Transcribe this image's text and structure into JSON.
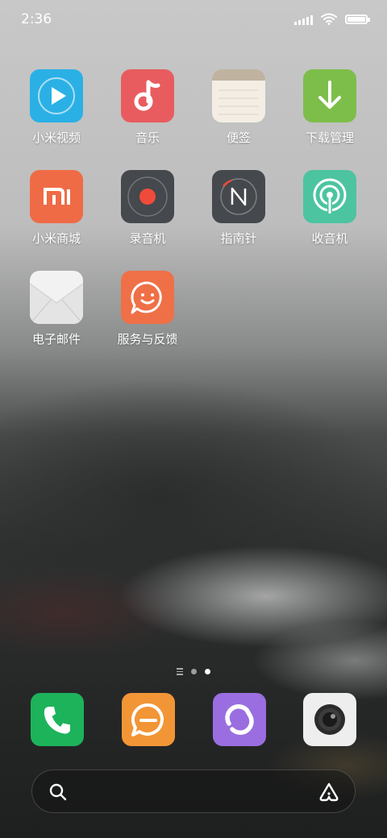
{
  "status_bar": {
    "time": "2:36",
    "icons": [
      "signal-icon",
      "wifi-icon",
      "battery-icon"
    ],
    "battery_level": 1.0
  },
  "apps": [
    {
      "label": "小米视频",
      "icon": "video-play-icon",
      "color": "#2bb0e6"
    },
    {
      "label": "音乐",
      "icon": "music-note-icon",
      "color": "#e85c5f"
    },
    {
      "label": "便签",
      "icon": "notes-icon",
      "color": "#f3ede4"
    },
    {
      "label": "下载管理",
      "icon": "download-arrow-icon",
      "color": "#7dbe4a"
    },
    {
      "label": "小米商城",
      "icon": "mi-logo-icon",
      "color": "#ef6b46"
    },
    {
      "label": "录音机",
      "icon": "record-icon",
      "color": "#45484c"
    },
    {
      "label": "指南针",
      "icon": "compass-icon",
      "color": "#45484c"
    },
    {
      "label": "收音机",
      "icon": "radio-icon",
      "color": "#4cc4a0"
    },
    {
      "label": "电子邮件",
      "icon": "envelope-icon",
      "color": "#f2f2f2"
    },
    {
      "label": "服务与反馈",
      "icon": "smiley-chat-icon",
      "color": "#ef7047"
    }
  ],
  "page_indicator": {
    "pages": 2,
    "active_page": 2
  },
  "dock": [
    {
      "name": "phone",
      "icon": "phone-icon",
      "color": "#1db35b"
    },
    {
      "name": "messages",
      "icon": "message-bubble-icon",
      "color": "#f29536"
    },
    {
      "name": "browser",
      "icon": "browser-icon",
      "color": "#9a6ee0"
    },
    {
      "name": "camera",
      "icon": "camera-icon",
      "color": "#eeeeee"
    }
  ],
  "search_bar": {
    "placeholder": "",
    "left_icon": "search-icon",
    "right_icon": "assistant-icon"
  }
}
